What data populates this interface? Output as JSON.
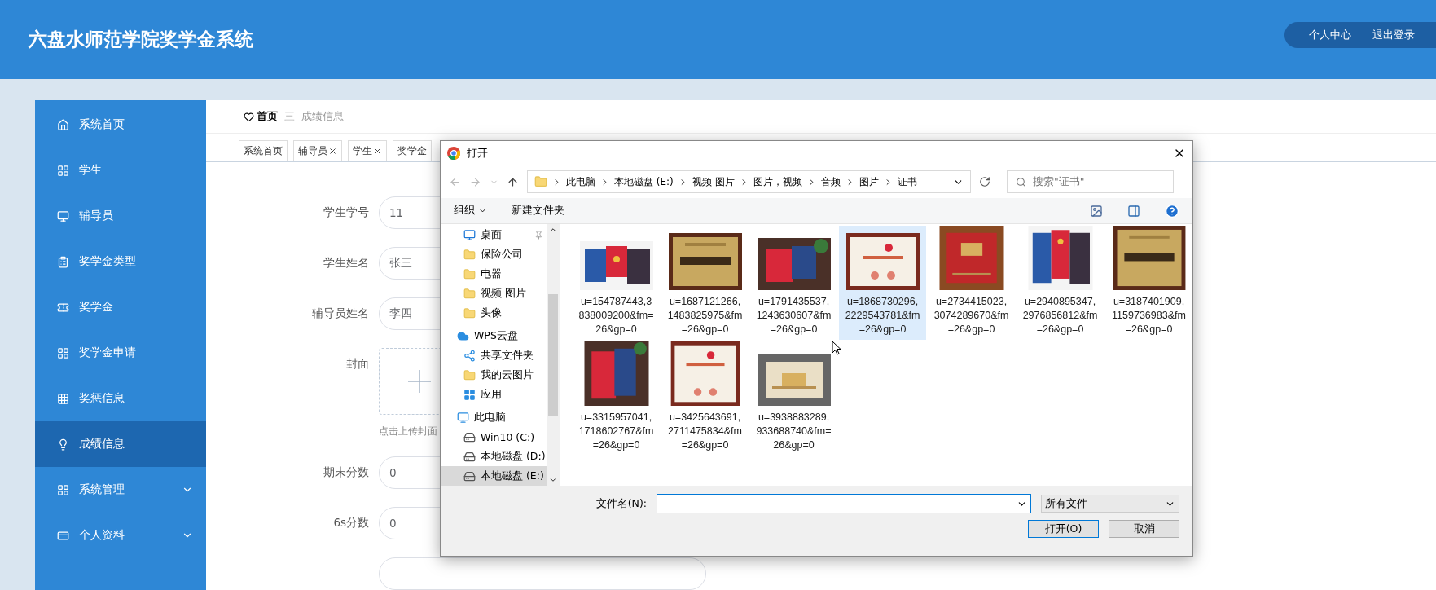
{
  "header": {
    "title": "六盘水师范学院奖学金系统",
    "links": [
      "个人中心",
      "退出登录"
    ]
  },
  "sidebar": {
    "items": [
      {
        "label": "系统首页",
        "kind": "link",
        "selected": false
      },
      {
        "label": "学生",
        "kind": "link",
        "selected": false
      },
      {
        "label": "辅导员",
        "kind": "link",
        "selected": false
      },
      {
        "label": "奖学金类型",
        "kind": "link",
        "selected": false
      },
      {
        "label": "奖学金",
        "kind": "link",
        "selected": false
      },
      {
        "label": "奖学金申请",
        "kind": "link",
        "selected": false
      },
      {
        "label": "奖惩信息",
        "kind": "link",
        "selected": false
      },
      {
        "label": "成绩信息",
        "kind": "link",
        "selected": true
      },
      {
        "label": "系统管理",
        "kind": "group",
        "selected": false
      },
      {
        "label": "个人资料",
        "kind": "group",
        "selected": false
      }
    ]
  },
  "breadcrumb": {
    "home": "首页",
    "separator": "三",
    "current": "成绩信息"
  },
  "tabs": [
    {
      "label": "系统首页",
      "closable": false
    },
    {
      "label": "辅导员",
      "closable": true
    },
    {
      "label": "学生",
      "closable": true
    },
    {
      "label": "奖学金",
      "closable": false
    }
  ],
  "form": {
    "fields": [
      {
        "kind": "input",
        "label": "学生学号",
        "value": "11"
      },
      {
        "kind": "input",
        "label": "学生姓名",
        "value": "张三"
      },
      {
        "kind": "input",
        "label": "辅导员姓名",
        "value": "李四"
      },
      {
        "kind": "upload",
        "label": "封面",
        "hint": "点击上传封面"
      },
      {
        "kind": "input",
        "label": "期末分数",
        "value": "0"
      },
      {
        "kind": "input",
        "label": "6s分数",
        "value": "0"
      },
      {
        "kind": "input"
      }
    ]
  },
  "dialog": {
    "title": "打开",
    "path": [
      "此电脑",
      "本地磁盘 (E:)",
      "视频 图片",
      "图片，视频",
      "音频",
      "图片",
      "证书"
    ],
    "search": {
      "placeholder": "搜索\"证书\""
    },
    "toolbar": [
      "组织",
      "新建文件夹"
    ],
    "nav": [
      {
        "label": "桌面",
        "kind": "desktop",
        "selected": false
      },
      {
        "label": "保险公司",
        "kind": "folder",
        "selected": false
      },
      {
        "label": "电器",
        "kind": "folder",
        "selected": false
      },
      {
        "label": "视频 图片",
        "kind": "folder",
        "selected": false
      },
      {
        "label": "头像",
        "kind": "folder",
        "selected": false
      },
      {
        "label": "WPS云盘",
        "kind": "cloud",
        "selected": false
      },
      {
        "label": "共享文件夹",
        "kind": "share",
        "selected": false
      },
      {
        "label": "我的云图片",
        "kind": "folder",
        "selected": false
      },
      {
        "label": "应用",
        "kind": "apps",
        "selected": false
      },
      {
        "label": "此电脑",
        "kind": "pc",
        "selected": false
      },
      {
        "label": "Win10 (C:)",
        "kind": "drive",
        "selected": false
      },
      {
        "label": "本地磁盘 (D:)",
        "kind": "drive",
        "selected": false
      },
      {
        "label": "本地磁盘 (E:)",
        "kind": "drive",
        "selected": true
      }
    ],
    "files": [
      {
        "name": "u=154787443,3838009200&fm=26&gp=0",
        "selected": false
      },
      {
        "name": "u=1687121266,1483825975&fm=26&gp=0",
        "selected": false
      },
      {
        "name": "u=1791435537,1243630607&fm=26&gp=0",
        "selected": false
      },
      {
        "name": "u=1868730296,2229543781&fm=26&gp=0",
        "selected": true
      },
      {
        "name": "u=2734415023,3074289670&fm=26&gp=0",
        "selected": false
      },
      {
        "name": "u=2940895347,2976856812&fm=26&gp=0",
        "selected": false
      },
      {
        "name": "u=3187401909,1159736983&fm=26&gp=0",
        "selected": false
      },
      {
        "name": "u=3315957041,1718602767&fm=26&gp=0",
        "selected": false
      },
      {
        "name": "u=3425643691,2711475834&fm=26&gp=0",
        "selected": false
      },
      {
        "name": "u=3938883289,933688740&fm=26&gp=0",
        "selected": false
      }
    ],
    "filename_label": "文件名(N):",
    "filter": "所有文件",
    "buttons": [
      "打开(O)",
      "取消"
    ]
  }
}
